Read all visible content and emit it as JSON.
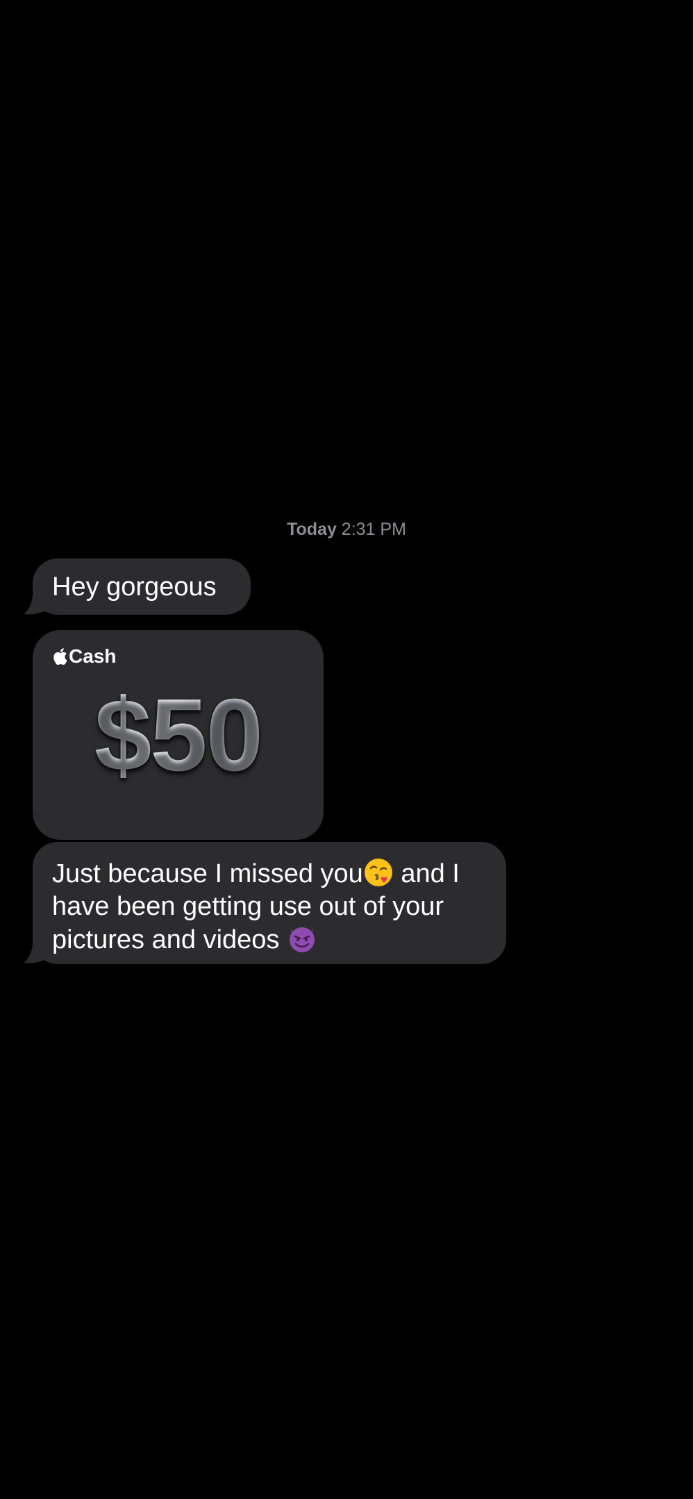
{
  "conversation": {
    "timestamp_day": "Today",
    "timestamp_time": "2:31 PM",
    "messages": [
      {
        "text": "Hey gorgeous"
      },
      {
        "cash_brand": "Cash",
        "amount": "$50"
      },
      {
        "text_part1": "Just because I missed you",
        "emoji1": "face-blowing-kiss-emoji",
        "text_part2": " and I have been getting use out of your pictures and videos ",
        "emoji2": "smiling-face-with-horns-emoji"
      }
    ]
  },
  "colors": {
    "background": "#000000",
    "bubble": "#2c2c2e",
    "timestamp": "#8e8e93",
    "text": "#ffffff"
  }
}
